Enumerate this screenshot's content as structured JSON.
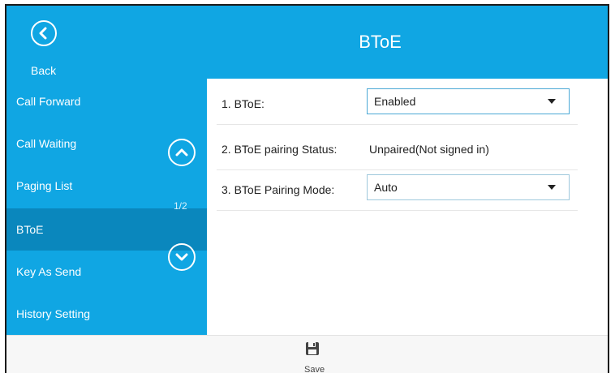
{
  "header": {
    "title": "BToE",
    "back_label": "Back",
    "background_color": "#10a6e3"
  },
  "sidebar": {
    "items": [
      {
        "label": "Call Forward",
        "active": false
      },
      {
        "label": "Call Waiting",
        "active": false
      },
      {
        "label": "Paging List",
        "active": false
      },
      {
        "label": "BToE",
        "active": true
      },
      {
        "label": "Key As Send",
        "active": false
      },
      {
        "label": "History Setting",
        "active": false
      }
    ],
    "page_indicator": "1/2",
    "up_icon": "chevron-up-icon",
    "down_icon": "chevron-down-icon",
    "active_color": "#0a87bd"
  },
  "settings": {
    "rows": [
      {
        "label": "1. BToE:",
        "type": "select",
        "value": "Enabled"
      },
      {
        "label": "2. BToE pairing Status:",
        "type": "text",
        "value": "Unpaired(Not signed in)"
      },
      {
        "label": "3. BToE Pairing Mode:",
        "type": "select",
        "value": "Auto"
      }
    ]
  },
  "footer": {
    "save_label": "Save",
    "save_icon": "floppy-disk-icon"
  }
}
